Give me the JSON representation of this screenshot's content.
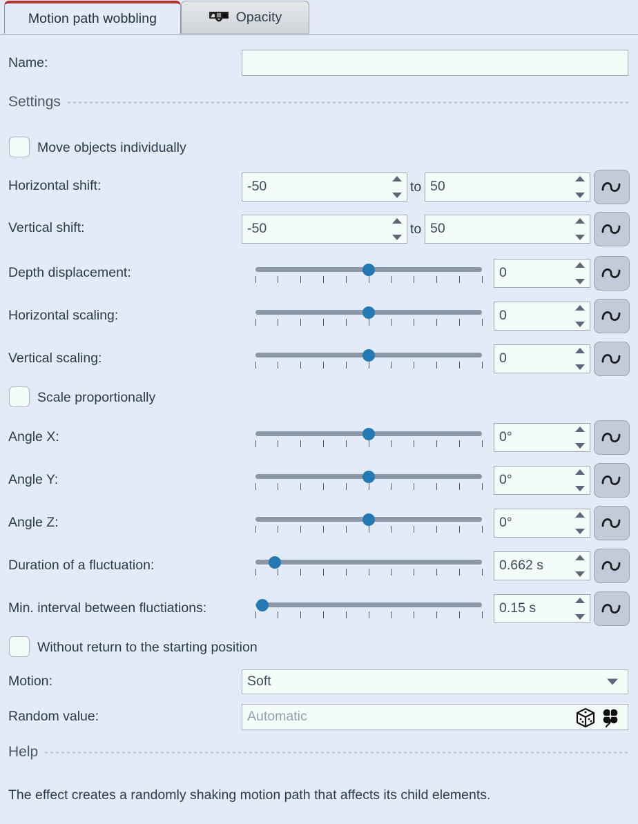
{
  "window": {
    "title": "Motion path wobbling",
    "background_color": "#e3ebf7",
    "accent_color": "#b5332b"
  },
  "tabs": [
    {
      "label": "Motion path wobbling",
      "active": true,
      "icon": ""
    },
    {
      "label": "Opacity",
      "active": false,
      "icon": "opacity-wave-icon"
    }
  ],
  "name_row": {
    "label": "Name:",
    "value": "",
    "placeholder": ""
  },
  "sections": {
    "settings": "Settings",
    "help": "Help"
  },
  "checkboxes": [
    {
      "label": "Move objects individually",
      "checked": false
    },
    {
      "label": "Scale proportionally",
      "checked": false
    },
    {
      "label": "Without return to the starting position",
      "checked": false
    }
  ],
  "range_rows": [
    {
      "label": "Horizontal shift:",
      "from": "-50",
      "to_label": "to",
      "to": "50",
      "randomize_icon": "wave-icon"
    },
    {
      "label": "Vertical shift:",
      "from": "-50",
      "to_label": "to",
      "to": "50",
      "randomize_icon": "wave-icon"
    }
  ],
  "slider_rows": [
    {
      "label": "Depth displacement:",
      "value": "0",
      "knob_percent": 50,
      "ticks": 11,
      "randomize_icon": "wave-icon"
    },
    {
      "label": "Horizontal scaling:",
      "value": "0",
      "knob_percent": 50,
      "ticks": 11,
      "randomize_icon": "wave-icon"
    },
    {
      "label": "Vertical scaling:",
      "value": "0",
      "knob_percent": 50,
      "ticks": 11,
      "randomize_icon": "wave-icon"
    },
    {
      "label": "Angle X:",
      "value": "0°",
      "knob_percent": 50,
      "ticks": 11,
      "randomize_icon": "wave-icon"
    },
    {
      "label": "Angle Y:",
      "value": "0°",
      "knob_percent": 50,
      "ticks": 11,
      "randomize_icon": "wave-icon"
    },
    {
      "label": "Angle Z:",
      "value": "0°",
      "knob_percent": 50,
      "ticks": 11,
      "randomize_icon": "wave-icon"
    },
    {
      "label": "Duration of a fluctuation:",
      "value": "0.662 s",
      "knob_percent": 8.5,
      "ticks": 11,
      "randomize_icon": "wave-icon"
    },
    {
      "label": "Min. interval between fluctiations:",
      "value": "0.15 s",
      "knob_percent": 3,
      "ticks": 11,
      "randomize_icon": "wave-icon"
    }
  ],
  "motion_row": {
    "label": "Motion:",
    "value": "Soft",
    "options": [
      "Soft"
    ]
  },
  "random_row": {
    "label": "Random value:",
    "value": "",
    "placeholder": "Automatic",
    "icons": [
      "dice-icon",
      "clover-icon"
    ]
  },
  "help": {
    "text": "The effect creates a randomly shaking motion path that affects its child elements."
  }
}
